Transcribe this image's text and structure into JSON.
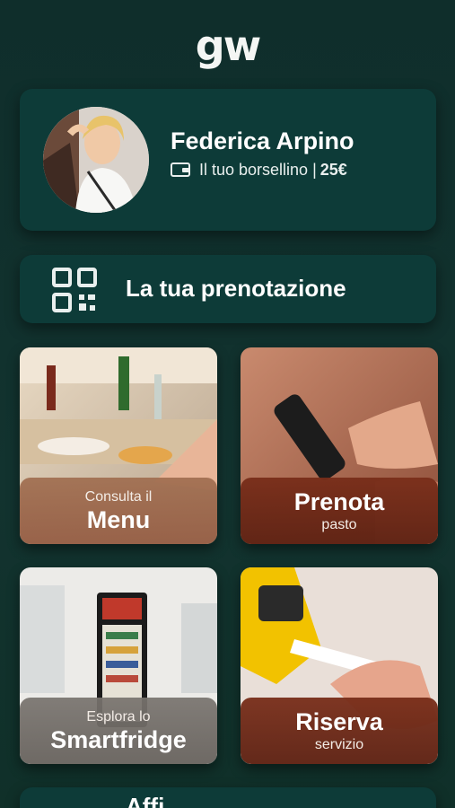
{
  "app": {
    "logo": "gw"
  },
  "profile": {
    "name": "Federica Arpino",
    "wallet_label": "Il tuo borsellino |",
    "wallet_amount": "25€"
  },
  "booking": {
    "label": "La tua prenotazione",
    "icon": "qr-code-icon"
  },
  "tiles": [
    {
      "small": "Consulta il",
      "big": "Menu"
    },
    {
      "big": "Prenota",
      "small": "pasto"
    },
    {
      "small": "Esplora lo",
      "big": "Smartfridge"
    },
    {
      "big": "Riserva",
      "small": "servizio"
    }
  ],
  "bottom": {
    "partial_label": "Affi"
  },
  "colors": {
    "background": "#10302d",
    "card": "#0d3b38",
    "text": "#ffffff"
  }
}
